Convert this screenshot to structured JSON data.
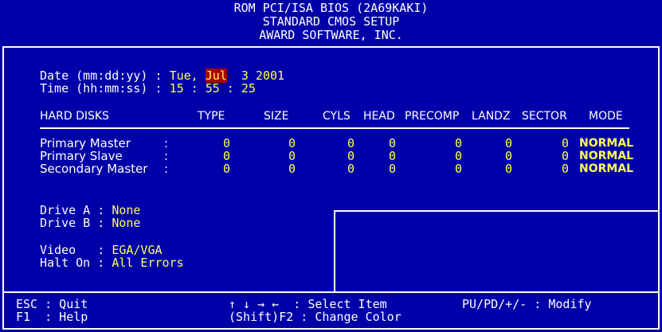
{
  "header": {
    "line1": "ROM PCI/ISA BIOS (2A69KAKI)",
    "line2": "STANDARD CMOS SETUP",
    "line3": "AWARD SOFTWARE, INC."
  },
  "date": {
    "label": "Date (mm:dd:yy) : ",
    "weekday": "Tue, ",
    "month": "Jul",
    "rest": "  3 2001"
  },
  "time": {
    "label": "Time (hh:mm:ss) : ",
    "hh": "15",
    "mm": "55",
    "ss": "25",
    "sep": " : "
  },
  "disks": {
    "headers": [
      "HARD DISKS",
      "TYPE",
      "SIZE",
      "CYLS",
      "HEAD",
      "PRECOMP",
      "LANDZ",
      "SECTOR",
      "MODE"
    ],
    "rows": [
      {
        "name": "Primary Master",
        "sep": ":",
        "type": "0",
        "size": "0",
        "cyls": "0",
        "head": "0",
        "precomp": "0",
        "landz": "0",
        "sector": "0",
        "mode": "NORMAL"
      },
      {
        "name": "Primary Slave",
        "sep": ":",
        "type": "0",
        "size": "0",
        "cyls": "0",
        "head": "0",
        "precomp": "0",
        "landz": "0",
        "sector": "0",
        "mode": "NORMAL"
      },
      {
        "name": "Secondary Master",
        "sep": ":",
        "type": "0",
        "size": "0",
        "cyls": "0",
        "head": "0",
        "precomp": "0",
        "landz": "0",
        "sector": "0",
        "mode": "NORMAL"
      }
    ]
  },
  "drives": {
    "a_label": "Drive A : ",
    "a_value": "None",
    "b_label": "Drive B : ",
    "b_value": "None"
  },
  "video": {
    "label": "Video   : ",
    "value": "EGA/VGA"
  },
  "halt": {
    "label": "Halt On : ",
    "value": "All Errors"
  },
  "footer": {
    "esc": "ESC : Quit",
    "f1": "F1  : Help",
    "arrows": "↑ ↓ → ←",
    "select": "  : Select Item",
    "shift": "(Shift)F2 : Change Color",
    "modify": "PU/PD/+/- : Modify"
  },
  "colors": {
    "background": "#0000a8",
    "text": "#ffffff",
    "value": "#ffff55",
    "highlight": "#a80000"
  }
}
